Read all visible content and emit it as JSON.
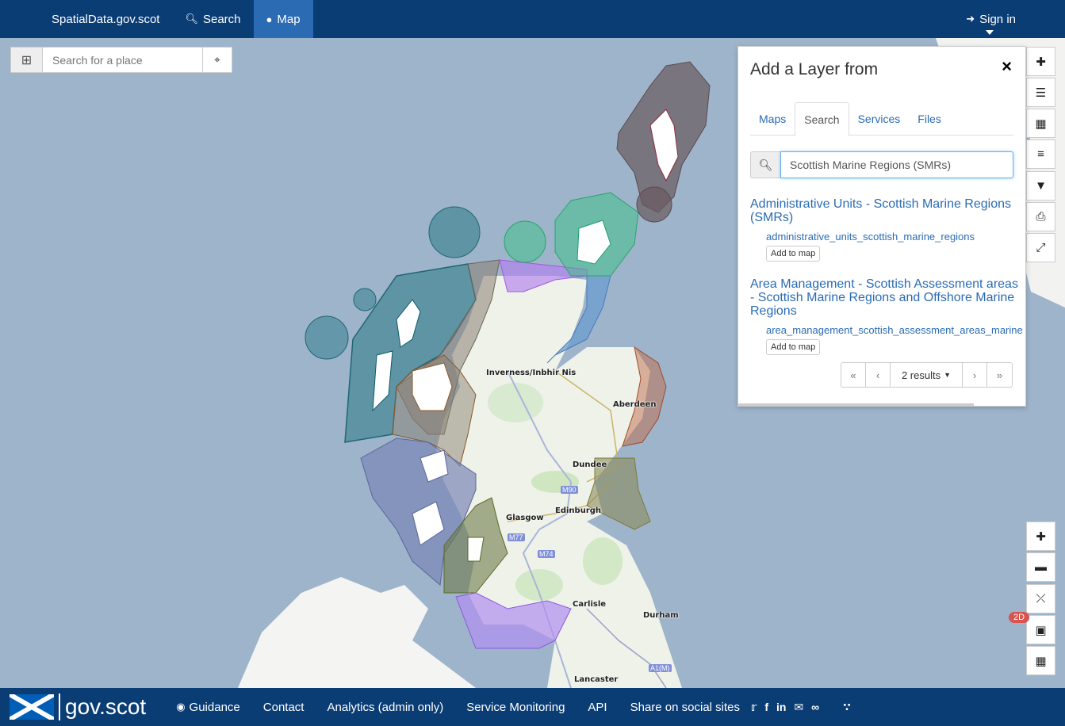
{
  "nav": {
    "brand": "SpatialData.gov.scot",
    "search_label": "Search",
    "map_label": "Map",
    "signin_label": "Sign in"
  },
  "place_search": {
    "placeholder": "Search for a place"
  },
  "map_labels": {
    "inverness": "Inverness/Inbhir Nis",
    "aberdeen": "Aberdeen",
    "dundee": "Dundee",
    "edinburgh": "Edinburgh",
    "glasgow": "Glasgow",
    "carlisle": "Carlisle",
    "durham": "Durham",
    "lancaster": "Lancaster",
    "m90": "M90",
    "m77": "M77",
    "m74": "M74",
    "a1m": "A1(M)"
  },
  "panel": {
    "title": "Add a Layer from",
    "close": "×",
    "tabs": [
      "Maps",
      "Search",
      "Services",
      "Files"
    ],
    "active_tab": "Search",
    "search_value": "Scottish Marine Regions (SMRs)",
    "results": [
      {
        "title": "Administrative Units - Scottish Marine Regions (SMRs)",
        "name": "administrative_units_scottish_marine_regions",
        "button": "Add to map"
      },
      {
        "title": "Area Management - Scottish Assessment areas - Scottish Marine Regions and Offshore Marine Regions",
        "name": "area_management_scottish_assessment_areas_marine",
        "button": "Add to map"
      }
    ],
    "pager": {
      "first": "«",
      "prev": "‹",
      "count": "2 results",
      "next": "›",
      "last": "»"
    }
  },
  "toolbar": {
    "badge": "2D"
  },
  "footer": {
    "logo_text": "gov.scot",
    "links": [
      "Guidance",
      "Contact",
      "Analytics (admin only)",
      "Service Monitoring",
      "API",
      "Share on social sites"
    ]
  },
  "colors": {
    "nav_bg": "#0b3d75",
    "accent": "#2a6bb3",
    "map_water": "#9db4cb"
  }
}
